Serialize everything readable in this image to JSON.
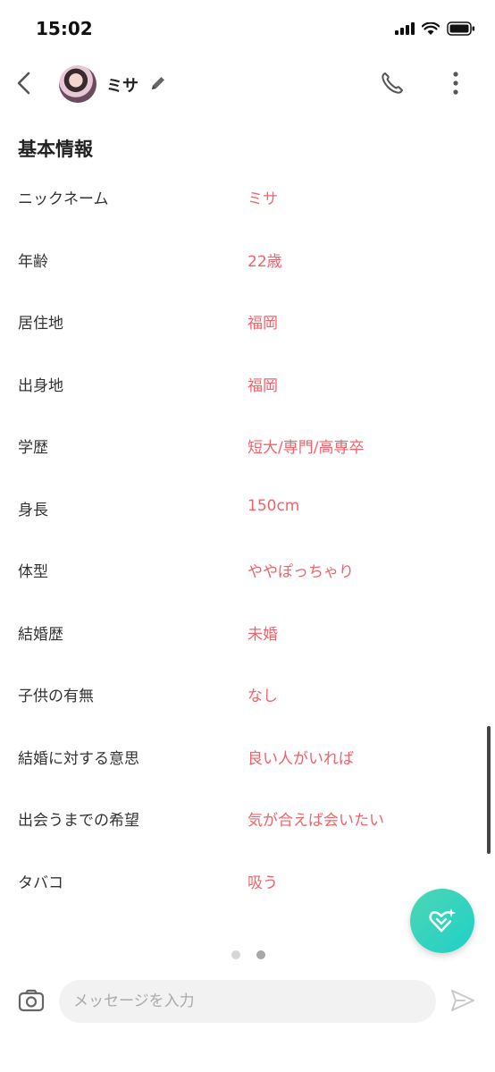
{
  "status_bar": {
    "time": "15:02"
  },
  "header": {
    "name": "ミサ"
  },
  "profile": {
    "section_title": "基本情報",
    "rows": [
      {
        "label": "ニックネーム",
        "value": "ミサ"
      },
      {
        "label": "年齢",
        "value": "22歳"
      },
      {
        "label": "居住地",
        "value": "福岡"
      },
      {
        "label": "出身地",
        "value": "福岡"
      },
      {
        "label": "学歴",
        "value": "短大/専門/高専卒"
      },
      {
        "label": "身長",
        "value": "150cm"
      },
      {
        "label": "体型",
        "value": "ややぽっちゃり"
      },
      {
        "label": "結婚歴",
        "value": "未婚"
      },
      {
        "label": "子供の有無",
        "value": "なし"
      },
      {
        "label": "結婚に対する意思",
        "value": "良い人がいれば"
      },
      {
        "label": "出会うまでの希望",
        "value": "気が合えば会いたい"
      },
      {
        "label": "タバコ",
        "value": "吸う"
      }
    ]
  },
  "pager": {
    "count": 2,
    "active_index": 1
  },
  "composer": {
    "placeholder": "メッセージを入力"
  },
  "colors": {
    "accent": "#f0636b",
    "fab": "#2fd3bf"
  }
}
